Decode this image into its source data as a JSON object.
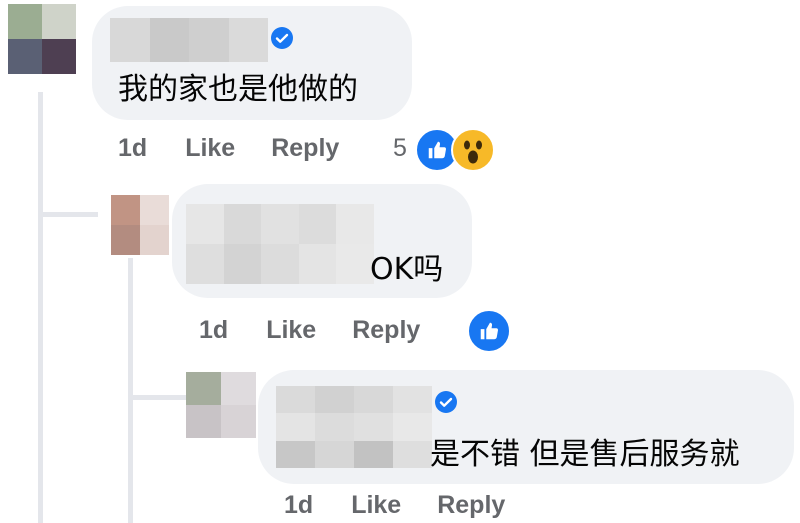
{
  "comments": [
    {
      "text": "我的家也是他做的",
      "actions": {
        "time": "1d",
        "like": "Like",
        "reply": "Reply"
      },
      "reaction_count": "5",
      "reactions": [
        "like-icon",
        "wow-icon"
      ],
      "verified": true
    },
    {
      "text": "OK吗",
      "actions": {
        "time": "1d",
        "like": "Like",
        "reply": "Reply"
      },
      "reactions": [
        "like-icon"
      ],
      "verified": false
    },
    {
      "text": "是不错 但是售后服务就",
      "actions": {
        "time": "1d",
        "like": "Like",
        "reply": "Reply"
      },
      "verified": true
    }
  ],
  "colors": {
    "bubble": "#f0f2f5",
    "action_text": "#65676b",
    "like_blue": "#1877f2",
    "thread_line": "#e4e6eb"
  }
}
